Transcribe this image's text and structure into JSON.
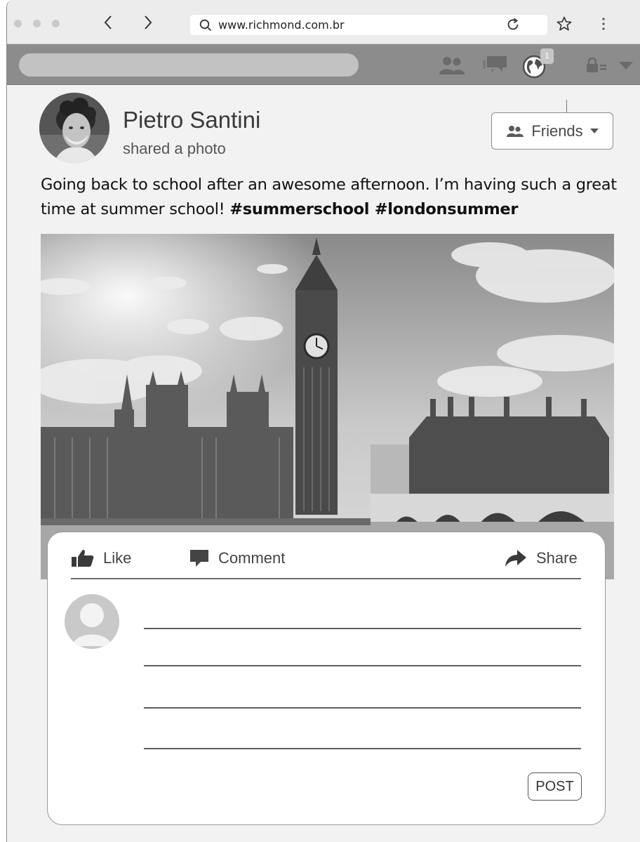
{
  "browser": {
    "url": "www.richmond.com.br",
    "icons": [
      "chevron-left-icon",
      "chevron-right-icon",
      "search-icon",
      "reload-icon",
      "star-icon",
      "more-vertical-icon"
    ]
  },
  "site_bar": {
    "notification_count": "1",
    "icons": [
      "friend-requests-icon",
      "messages-icon",
      "notifications-globe-icon",
      "privacy-lock-icon",
      "dropdown-caret-icon"
    ]
  },
  "post": {
    "author_name": "Pietro Santini",
    "author_action": "shared a photo",
    "audience_label": "Friends",
    "text_plain": "Going back to school after an awesome afternoon. I’m having such a great time at summer school! ",
    "hashtags": "#summerschool #londonsummer",
    "photo_subject": "big-ben-westminster-photo"
  },
  "actions": {
    "like_label": "Like",
    "comment_label": "Comment",
    "share_label": "Share"
  },
  "comment_box": {
    "post_label": "POST"
  },
  "colors": {
    "site_bar": "#8c8c8c",
    "search_field": "#c2c2c2",
    "page_bg": "#f2f2f2"
  }
}
